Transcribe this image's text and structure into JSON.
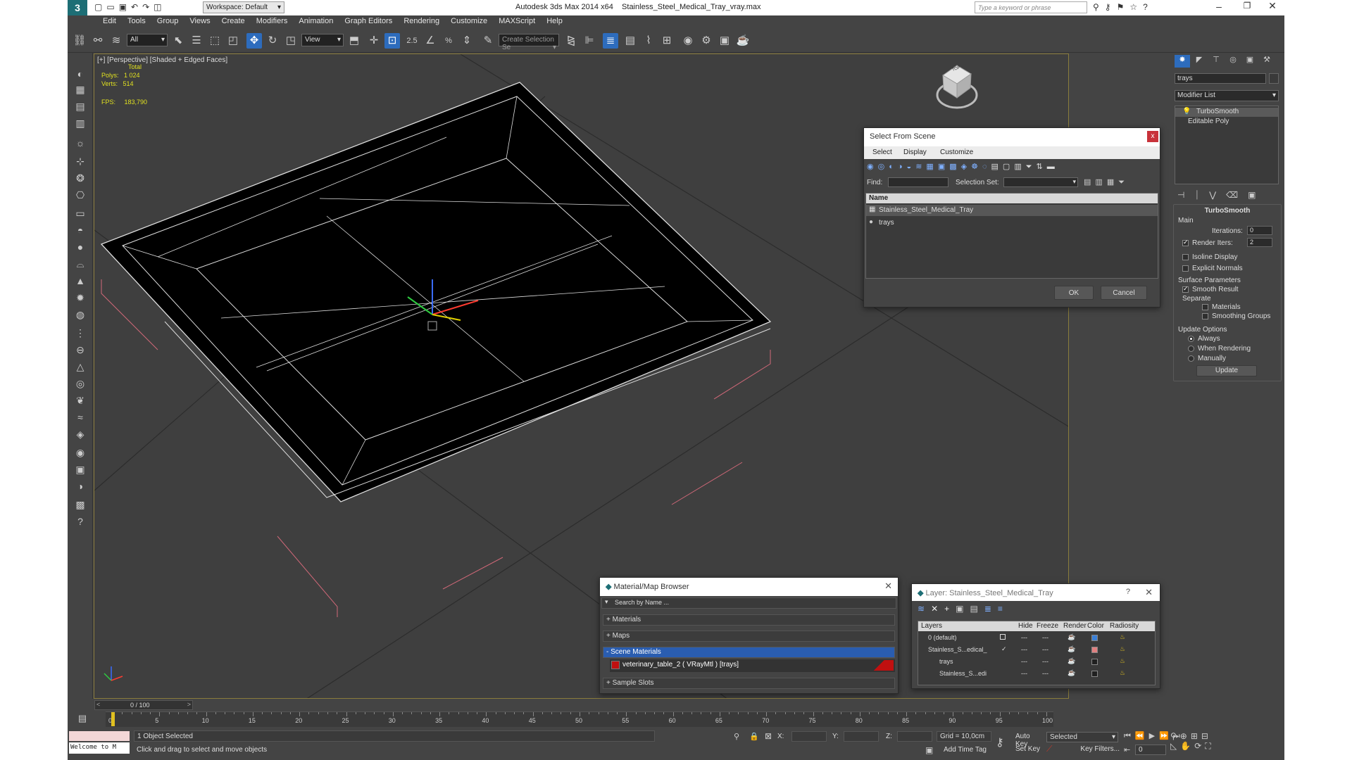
{
  "title_bar": {
    "workspace": "Workspace: Default",
    "title": "Autodesk 3ds Max  2014 x64",
    "file": "Stainless_Steel_Medical_Tray_vray.max",
    "search_placeholder": "Type a keyword or phrase"
  },
  "menu": [
    "Edit",
    "Tools",
    "Group",
    "Views",
    "Create",
    "Modifiers",
    "Animation",
    "Graph Editors",
    "Rendering",
    "Customize",
    "MAXScript",
    "Help"
  ],
  "toolbar": {
    "filter": "All",
    "ref_coord": "View",
    "snap_value": "2.5",
    "named_selection": "Create Selection Se"
  },
  "viewport": {
    "label": "[+] [Perspective] [Shaded + Edged Faces]",
    "stats": {
      "total": "Total",
      "polys_label": "Polys:",
      "polys": "1 024",
      "verts_label": "Verts:",
      "verts": "514",
      "fps_label": "FPS:",
      "fps": "183,790"
    },
    "viewcube_label": "TOP"
  },
  "select_from_scene": {
    "title": "Select From Scene",
    "menu": [
      "Select",
      "Display",
      "Customize"
    ],
    "find_label": "Find:",
    "selection_set_label": "Selection Set:",
    "column": "Name",
    "items": [
      "Stainless_Steel_Medical_Tray",
      "trays"
    ],
    "ok": "OK",
    "cancel": "Cancel"
  },
  "material_browser": {
    "title": "Material/Map Browser",
    "search_placeholder": "Search by Name ...",
    "groups": [
      "+ Materials",
      "+ Maps",
      "- Scene Materials",
      "+ Sample Slots"
    ],
    "scene_material": "veterinary_table_2  ( VRayMtl ) [trays]",
    "accent": "#2a5db0",
    "swatch_color": "#c01010"
  },
  "layer_dialog": {
    "title": "Layer: Stainless_Steel_Medical_Tray",
    "help": "?",
    "columns": [
      "Layers",
      "Hide",
      "Freeze",
      "Render",
      "Color",
      "Radiosity"
    ],
    "rows": [
      {
        "name": "0 (default)",
        "color": "#3a7fd6"
      },
      {
        "name": "Stainless_S...edical_",
        "color": "#e08080"
      },
      {
        "name": "trays",
        "color": "#202020"
      },
      {
        "name": "Stainless_S...edi",
        "color": "#202020"
      }
    ]
  },
  "command_panel": {
    "object_name": "trays",
    "modifier_list": "Modifier List",
    "stack": [
      "TurboSmooth",
      "Editable Poly"
    ],
    "rollout": "TurboSmooth",
    "main": "Main",
    "iterations_label": "Iterations:",
    "iterations": "0",
    "render_iters_label": "Render Iters:",
    "render_iters": "2",
    "isoline": "Isoline Display",
    "explicit_normals": "Explicit Normals",
    "surface_params": "Surface Parameters",
    "smooth_result": "Smooth Result",
    "separate": "Separate",
    "materials": "Materials",
    "smoothing_groups": "Smoothing Groups",
    "update_options": "Update Options",
    "always": "Always",
    "when_rendering": "When Rendering",
    "manually": "Manually",
    "update": "Update"
  },
  "timeline": {
    "frame": "0 / 100",
    "ticks": [
      "0",
      "5",
      "10",
      "15",
      "20",
      "25",
      "30",
      "35",
      "40",
      "45",
      "50",
      "55",
      "60",
      "65",
      "70",
      "75",
      "80",
      "85",
      "90",
      "95",
      "100"
    ]
  },
  "status": {
    "selected": "1 Object Selected",
    "prompt": "Click and drag to select and move objects",
    "welcome": "Welcome to M",
    "x_label": "X:",
    "y_label": "Y:",
    "z_label": "Z:",
    "grid": "Grid = 10,0cm",
    "auto_key": "Auto Key",
    "set_key": "Set Key",
    "selected_dropdown": "Selected",
    "key_filters": "Key Filters...",
    "add_time_tag": "Add Time Tag",
    "frame_value": "0"
  }
}
